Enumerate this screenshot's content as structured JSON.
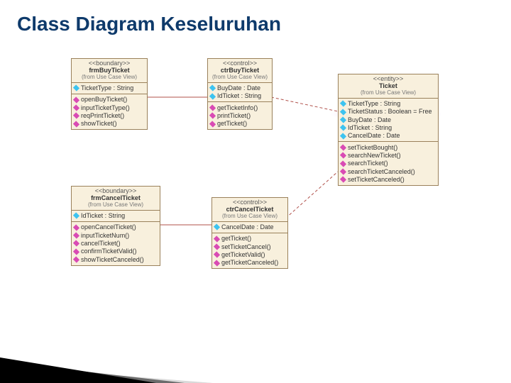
{
  "title": "Class Diagram Keseluruhan",
  "from_label": "(from Use Case View)",
  "classes": {
    "frmBuyTicket": {
      "stereotype": "<<boundary>>",
      "name": "frmBuyTicket",
      "attributes": [
        {
          "text": "TicketType : String"
        }
      ],
      "operations": [
        {
          "text": "openBuyTicket()"
        },
        {
          "text": "inputTicketType()"
        },
        {
          "text": "reqPrintTicket()"
        },
        {
          "text": "showTicket()"
        }
      ]
    },
    "ctrBuyTicket": {
      "stereotype": "<<control>>",
      "name": "ctrBuyTicket",
      "attributes": [
        {
          "text": "BuyDate : Date"
        },
        {
          "text": "IdTicket : String"
        }
      ],
      "operations": [
        {
          "text": "getTicketInfo()"
        },
        {
          "text": "printTicket()"
        },
        {
          "text": "getTicket()"
        }
      ]
    },
    "Ticket": {
      "stereotype": "<<entity>>",
      "name": "Ticket",
      "attributes": [
        {
          "text": "TicketType : String"
        },
        {
          "text": "TicketStatus : Boolean = Free"
        },
        {
          "text": "BuyDate : Date"
        },
        {
          "text": "IdTicket : String"
        },
        {
          "text": "CancelDate : Date"
        }
      ],
      "operations": [
        {
          "text": "setTicketBought()"
        },
        {
          "text": "searchNewTicket()"
        },
        {
          "text": "searchTicket()"
        },
        {
          "text": "searchTicketCanceled()"
        },
        {
          "text": "setTicketCanceled()"
        }
      ]
    },
    "frmCancelTicket": {
      "stereotype": "<<boundary>>",
      "name": "frmCancelTicket",
      "attributes": [
        {
          "text": "IdTicket : String"
        }
      ],
      "operations": [
        {
          "text": "openCancelTicket()"
        },
        {
          "text": "inputTicketNum()"
        },
        {
          "text": "cancelTicket()"
        },
        {
          "text": "confirmTicketValid()"
        },
        {
          "text": "showTicketCanceled()"
        }
      ]
    },
    "ctrCancelTicket": {
      "stereotype": "<<control>>",
      "name": "ctrCancelTicket",
      "attributes": [
        {
          "text": "CancelDate : Date"
        }
      ],
      "operations": [
        {
          "text": "getTicket()"
        },
        {
          "text": "setTicketCancel()"
        },
        {
          "text": "getTicketValid()"
        },
        {
          "text": "getTicketCanceled()"
        }
      ]
    }
  },
  "chart_data": {
    "type": "uml-class-diagram",
    "classes": [
      {
        "id": "frmBuyTicket",
        "stereotype": "boundary"
      },
      {
        "id": "ctrBuyTicket",
        "stereotype": "control"
      },
      {
        "id": "Ticket",
        "stereotype": "entity"
      },
      {
        "id": "frmCancelTicket",
        "stereotype": "boundary"
      },
      {
        "id": "ctrCancelTicket",
        "stereotype": "control"
      }
    ],
    "associations": [
      {
        "from": "frmBuyTicket",
        "to": "ctrBuyTicket",
        "style": "solid"
      },
      {
        "from": "frmCancelTicket",
        "to": "ctrCancelTicket",
        "style": "solid"
      },
      {
        "from": "ctrBuyTicket",
        "to": "Ticket",
        "style": "dashed"
      },
      {
        "from": "ctrCancelTicket",
        "to": "Ticket",
        "style": "dashed"
      }
    ]
  }
}
